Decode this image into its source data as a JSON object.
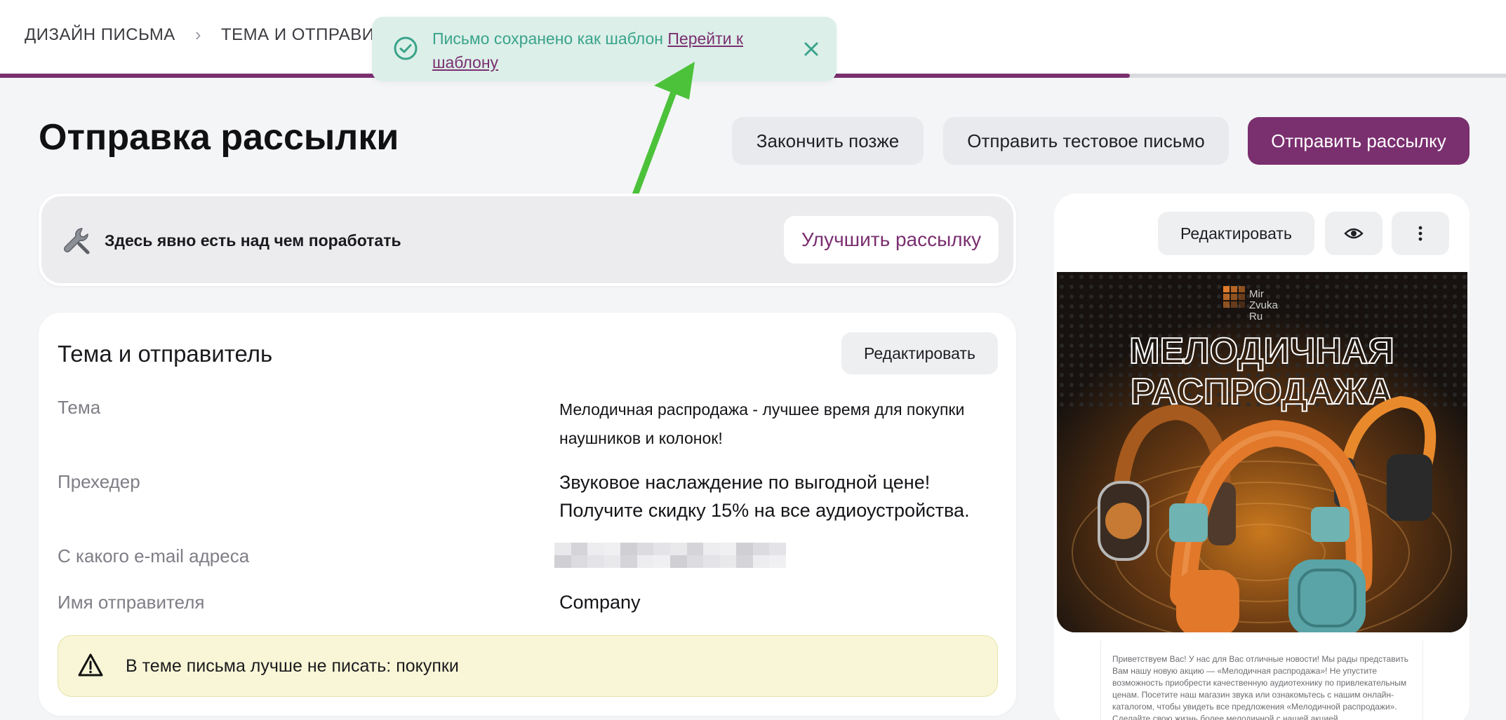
{
  "breadcrumbs": {
    "step1": "ДИЗАЙН ПИСЬМА",
    "step2": "ТЕМА И ОТПРАВИТЕ"
  },
  "progress": {
    "fraction": 0.75,
    "fill_color": "#7a2f6f",
    "track_color": "#d9dade"
  },
  "toast": {
    "message": "Письмо сохранено как шаблон",
    "link_text": "Перейти к шаблону",
    "icon": "check-circle-icon",
    "close_icon": "close-icon"
  },
  "annotation": {
    "icon": "green-arrow-icon",
    "color": "#4cc23a"
  },
  "page": {
    "title": "Отправка рассылки"
  },
  "actions": {
    "finish_later": "Закончить позже",
    "send_test": "Отправить тестовое письмо",
    "send": "Отправить рассылку"
  },
  "hint": {
    "icon": "wrench-icon",
    "text": "Здесь явно есть над чем поработать",
    "button": "Улучшить рассылку"
  },
  "subject_card": {
    "title": "Тема и отправитель",
    "edit_button": "Редактировать",
    "rows": [
      {
        "label": "Тема",
        "value": "Мелодичная распродажа - лучшее время для покупки наушников и колонок!"
      },
      {
        "label": "Прехедер",
        "value": "Звуковое наслаждение по выгодной цене! Получите скидку 15% на все аудиоустройства."
      },
      {
        "label": "С какого e-mail адреса",
        "value": ""
      },
      {
        "label": "Имя отправителя",
        "value": "Company"
      }
    ],
    "warning": {
      "icon": "warning-triangle-icon",
      "text": "В теме письма лучше не писать: покупки"
    }
  },
  "preview": {
    "edit_button": "Редактировать",
    "eye_icon": "eye-icon",
    "more_icon": "more-vertical-icon",
    "banner": {
      "logo_lines": [
        "Mir",
        "Zvuka",
        "Ru"
      ],
      "headline_line1": "МЕЛОДИЧНАЯ",
      "headline_line2": "РАСПРОДАЖА"
    },
    "body_text": "Приветствуем Вас! У нас для Вас отличные новости! Мы рады представить Вам нашу новую акцию — «Мелодичная распродажа»! Не упустите возможность приобрести качественную аудиотехнику по привлекательным ценам. Посетите наш магазин звука или ознакомьтесь с нашим онлайн-каталогом, чтобы увидеть все предложения «Мелодичной распродажи». Сделайте свою жизнь более мелодичной с нашей акцией"
  },
  "colors": {
    "brand": "#7a2f6f",
    "toast_bg": "#dcefe9",
    "toast_text": "#3aa38a",
    "warning_bg": "#f8f6d6"
  }
}
